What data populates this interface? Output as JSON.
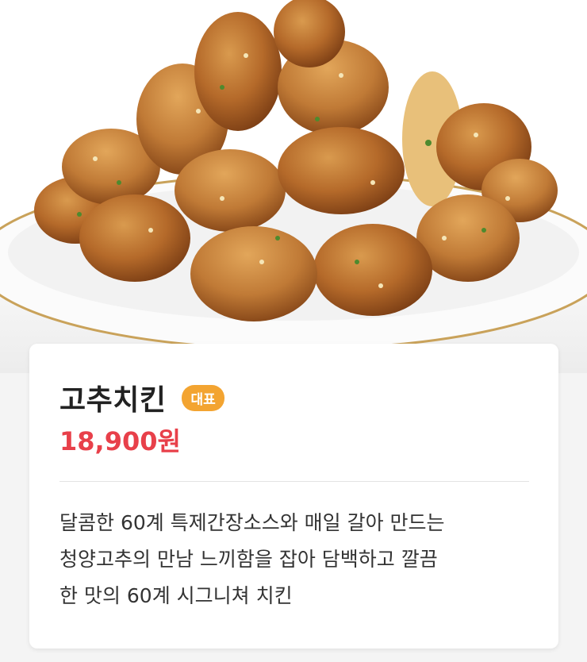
{
  "hero": {
    "image_description_icon": "fried-chicken-photo"
  },
  "menu": {
    "name": "고추치킨",
    "badge": "대표",
    "price": "18,900원",
    "description_lines": [
      "달콤한 60계 특제간장소스와 매일 갈아 만드는",
      "청양고추의 만남 느끼함을 잡아 담백하고 깔끔",
      "한 맛의 60계 시그니쳐 치킨"
    ]
  },
  "colors": {
    "price": "#e8404a",
    "badge": "#f3a431",
    "title": "#222222"
  }
}
